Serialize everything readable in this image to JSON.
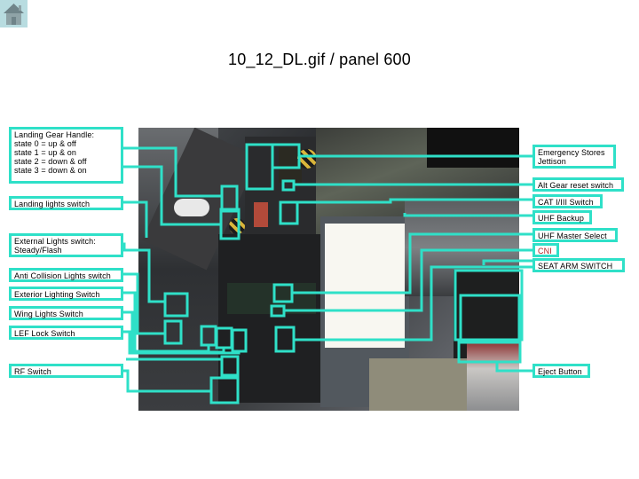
{
  "nav": {
    "home_icon": "home-icon"
  },
  "title": "10_12_DL.gif / panel 600",
  "colors": {
    "highlight": "#2fe0c8",
    "cni_text": "#b22222",
    "home_bg": "#b8dce0"
  },
  "left_labels": {
    "landing_gear": {
      "heading": "Landing Gear Handle:",
      "states": [
        "state 0 = up & off",
        "state 1 = up & on",
        "state 2 = down & off",
        "state 3 = down & on"
      ]
    },
    "landing_lights": "Landing lights switch",
    "external_lights": [
      "External Lights switch:",
      "Steady/Flash"
    ],
    "anti_collision": "Anti Collision Lights switch",
    "exterior_lighting": "Exterior Lighting Switch",
    "wing_lights": "Wing Lights Switch",
    "lef_lock": "LEF Lock Switch",
    "rf_switch": "RF Switch"
  },
  "right_labels": {
    "emergency_stores": [
      "Emergency Stores",
      "Jettison"
    ],
    "alt_gear_reset": "Alt Gear reset switch",
    "cat_switch": "CAT I/III Switch",
    "uhf_backup": "UHF Backup",
    "uhf_master": "UHF Master Select",
    "cni": "CNI",
    "seat_arm": "SEAT ARM SWITCH",
    "eject": "Eject Button"
  }
}
